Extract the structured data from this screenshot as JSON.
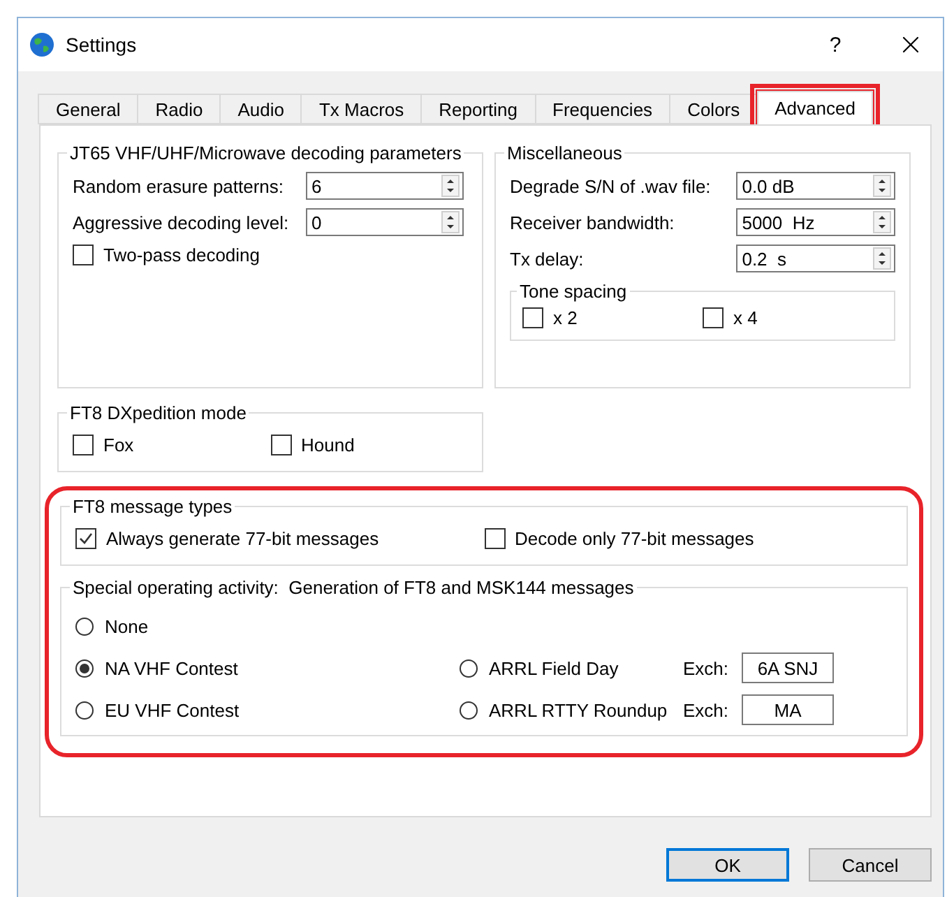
{
  "window": {
    "title": "Settings",
    "help": "?"
  },
  "tabs": [
    {
      "label": "General",
      "selected": false,
      "highlighted": false
    },
    {
      "label": "Radio",
      "selected": false,
      "highlighted": false
    },
    {
      "label": "Audio",
      "selected": false,
      "highlighted": false
    },
    {
      "label": "Tx Macros",
      "selected": false,
      "highlighted": false
    },
    {
      "label": "Reporting",
      "selected": false,
      "highlighted": false
    },
    {
      "label": "Frequencies",
      "selected": false,
      "highlighted": false
    },
    {
      "label": "Colors",
      "selected": false,
      "highlighted": false
    },
    {
      "label": "Advanced",
      "selected": true,
      "highlighted": true
    }
  ],
  "jt65": {
    "title": "JT65 VHF/UHF/Microwave decoding parameters",
    "fields": [
      {
        "label": "Random erasure patterns:",
        "value": "6"
      },
      {
        "label": "Aggressive decoding level:",
        "value": "0"
      }
    ],
    "options": [
      {
        "label": "Two-pass decoding",
        "checked": false
      }
    ]
  },
  "misc": {
    "title": "Miscellaneous",
    "fields": [
      {
        "label": "Degrade S/N of .wav file:",
        "value": "0.0 dB"
      },
      {
        "label": "Receiver bandwidth:",
        "value": "5000  Hz"
      },
      {
        "label": "Tx delay:",
        "value": "0.2  s"
      }
    ],
    "tone_spacing": {
      "title": "Tone spacing",
      "options": [
        {
          "label": "x 2",
          "checked": false
        },
        {
          "label": "x 4",
          "checked": false
        }
      ]
    }
  },
  "dxpedition": {
    "title": "FT8 DXpedition mode",
    "options": [
      {
        "label": "Fox",
        "checked": false
      },
      {
        "label": "Hound",
        "checked": false
      }
    ]
  },
  "message_section": {
    "highlighted": true,
    "message_types": {
      "title": "FT8 message types",
      "options": [
        {
          "label": "Always generate 77-bit messages",
          "checked": true
        },
        {
          "label": "Decode only 77-bit messages",
          "checked": false
        }
      ]
    },
    "special_activity": {
      "title": "Special operating activity:  Generation of FT8 and MSK144 messages",
      "options": [
        {
          "label": "None",
          "selected": false
        },
        {
          "label": "NA VHF Contest",
          "selected": true
        },
        {
          "label": "EU VHF Contest",
          "selected": false
        },
        {
          "label": "ARRL Field Day",
          "selected": false,
          "exch_label": "Exch:",
          "exch_value": "6A SNJ"
        },
        {
          "label": "ARRL RTTY Roundup",
          "selected": false,
          "exch_label": "Exch:",
          "exch_value": "MA"
        }
      ]
    }
  },
  "buttons": [
    {
      "label": "OK",
      "default": true
    },
    {
      "label": "Cancel",
      "default": false
    }
  ]
}
